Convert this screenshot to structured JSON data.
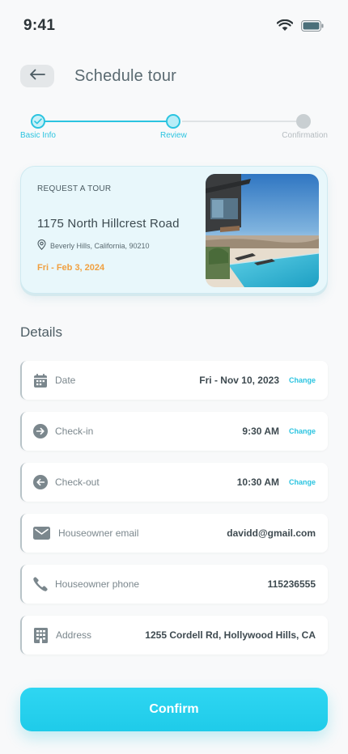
{
  "status_bar": {
    "time": "9:41",
    "wifi_icon": "wifi-icon",
    "battery_icon": "battery-icon"
  },
  "header": {
    "back_icon": "arrow-left-icon",
    "title": "Schedule tour"
  },
  "stepper": {
    "steps": [
      {
        "label": "Basic Info",
        "state": "completed"
      },
      {
        "label": "Review",
        "state": "current"
      },
      {
        "label": "Confirmation",
        "state": "upcoming"
      }
    ]
  },
  "tour_card": {
    "kicker": "REQUEST A TOUR",
    "address": "1175 North Hillcrest Road",
    "location": "Beverly Hills, California, 90210",
    "date": "Fri - Feb 3, 2024",
    "photo": "modern-house-with-infinity-pool"
  },
  "details": {
    "title": "Details",
    "rows": [
      {
        "icon": "calendar-icon",
        "label": "Date",
        "value": "Fri - Nov 10, 2023",
        "action": "Change"
      },
      {
        "icon": "arrow-right-circle-icon",
        "label": "Check-in",
        "value": "9:30 AM",
        "action": "Change"
      },
      {
        "icon": "arrow-left-circle-icon",
        "label": "Check-out",
        "value": "10:30 AM",
        "action": "Change"
      },
      {
        "icon": "mail-icon",
        "label": "Houseowner email",
        "value": "davidd@gmail.com"
      },
      {
        "icon": "phone-icon",
        "label": "Houseowner phone",
        "value": "115236555"
      },
      {
        "icon": "building-icon",
        "label": "Address",
        "value": "1255 Cordell Rd, Hollywood Hills, CA"
      }
    ]
  },
  "confirm_button": {
    "label": "Confirm"
  },
  "colors": {
    "accent": "#2bc4e0",
    "date_orange": "#f0a040",
    "card_bg": "#e8f7fb"
  }
}
